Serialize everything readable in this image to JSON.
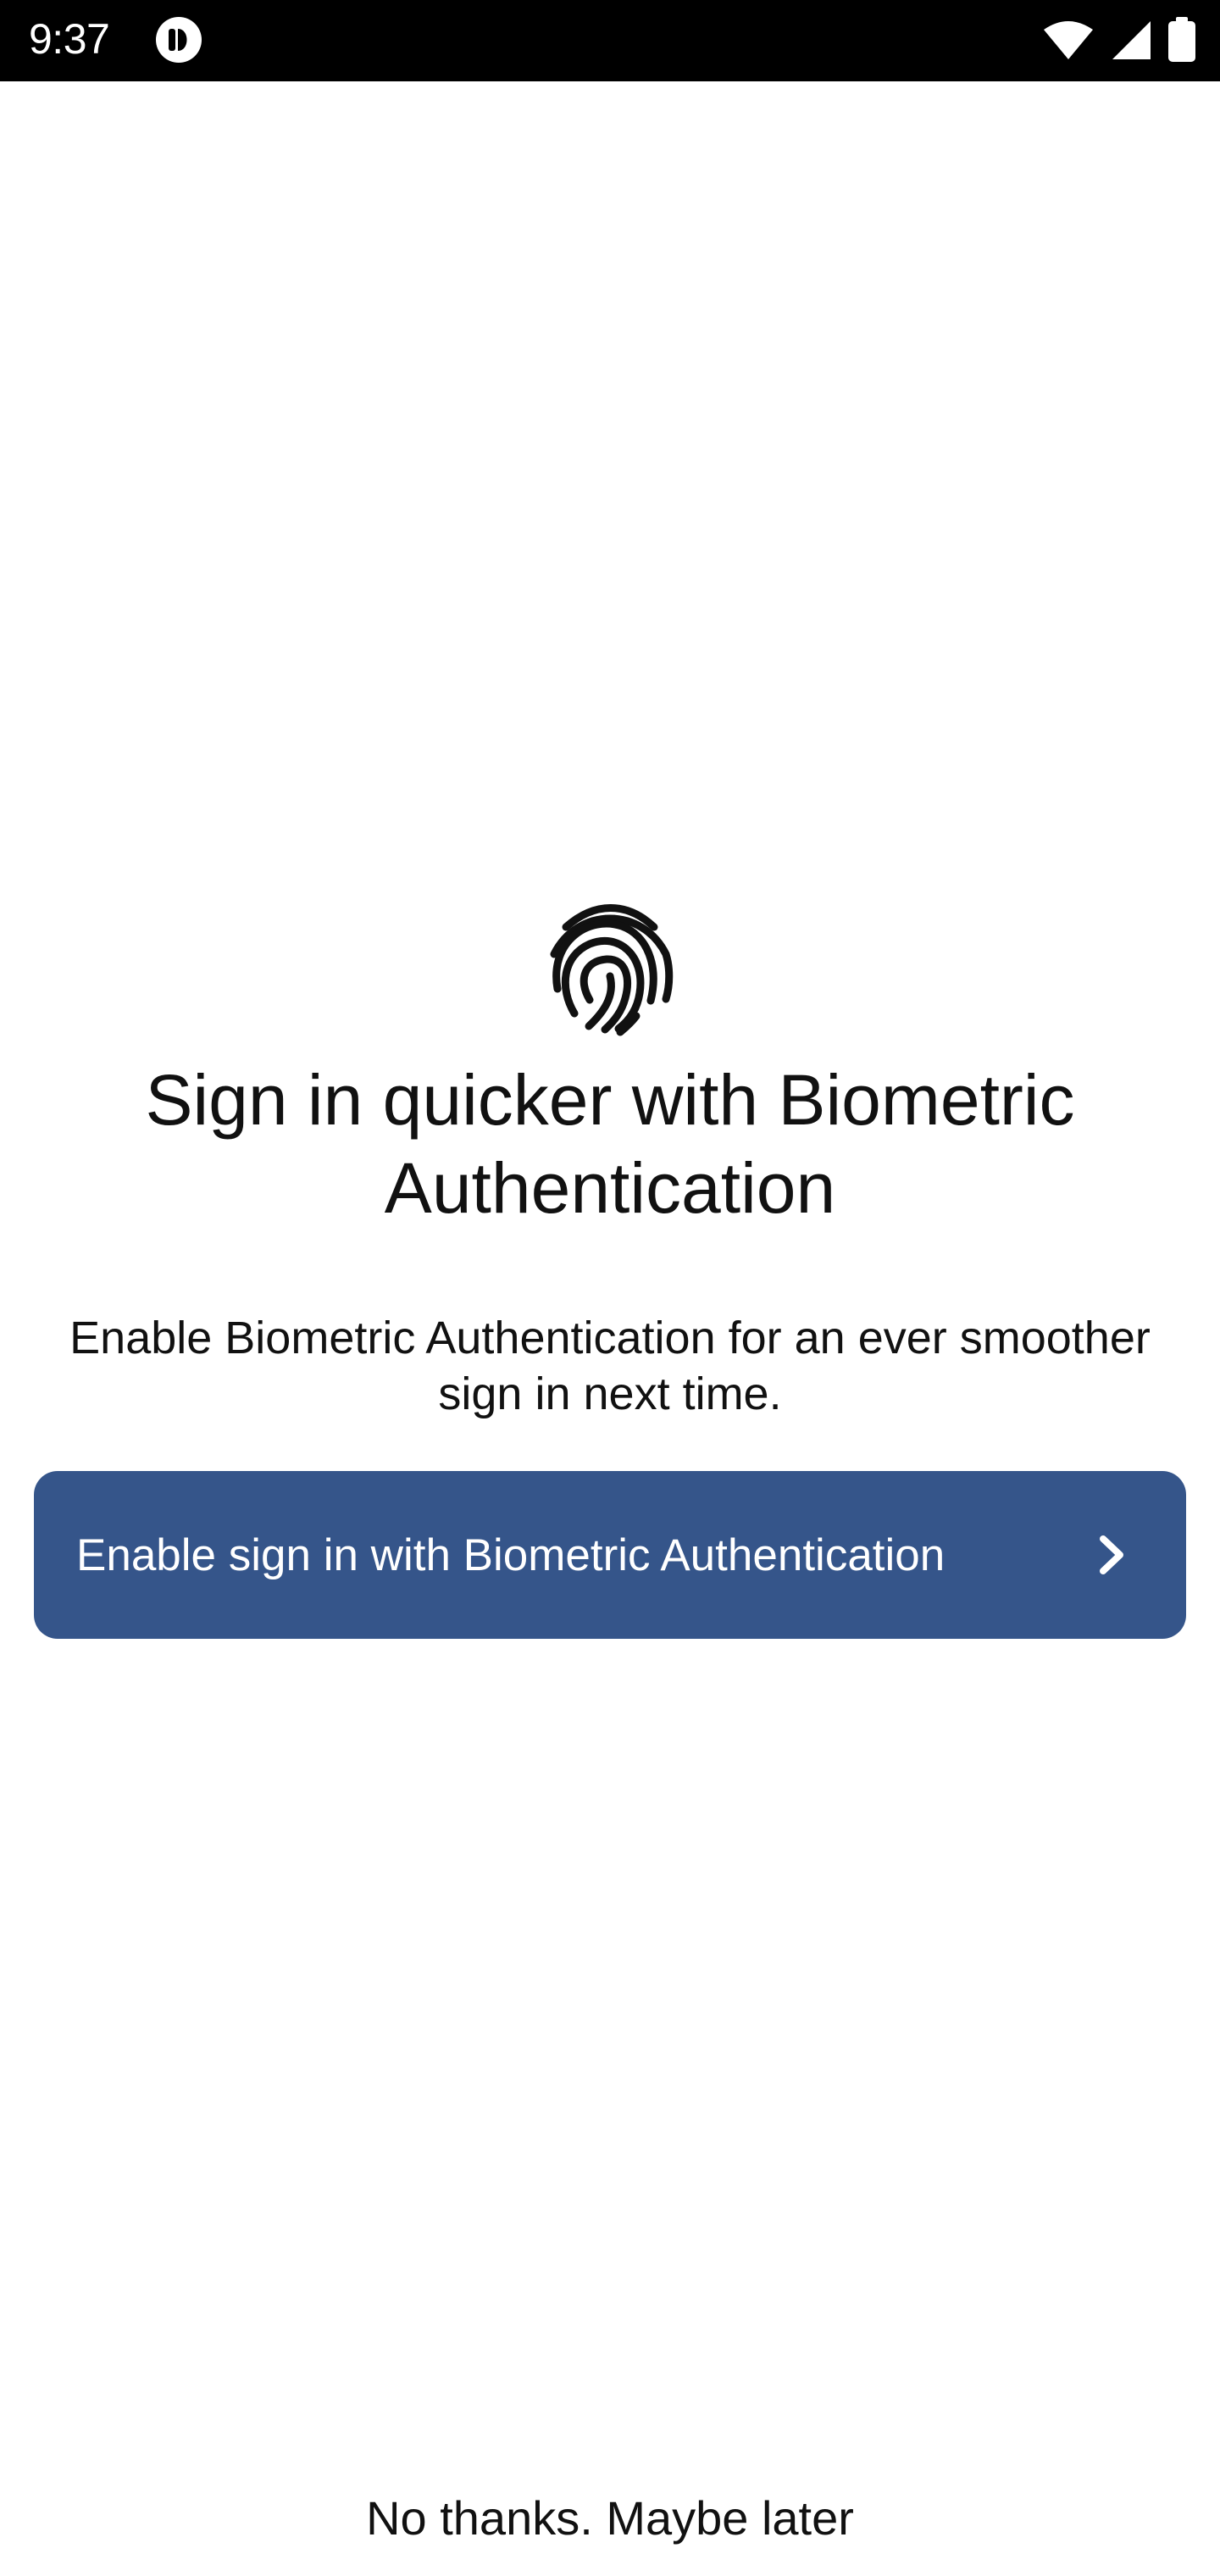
{
  "status_bar": {
    "time": "9:37",
    "icons": [
      "app-notification-icon",
      "wifi-icon",
      "cellular-signal-icon",
      "battery-icon"
    ]
  },
  "main": {
    "icon": "fingerprint-icon",
    "title": "Sign in quicker with Biometric Authentication",
    "subtitle": "Enable Biometric Authentication for an ever smoother sign in next time.",
    "enable_button_label": "Enable sign in with Biometric Authentication",
    "later_label": "No thanks. Maybe later"
  },
  "colors": {
    "primary": "#35558A",
    "status_bar_background": "#000000",
    "text": "#111111",
    "background": "#FFFFFF"
  }
}
